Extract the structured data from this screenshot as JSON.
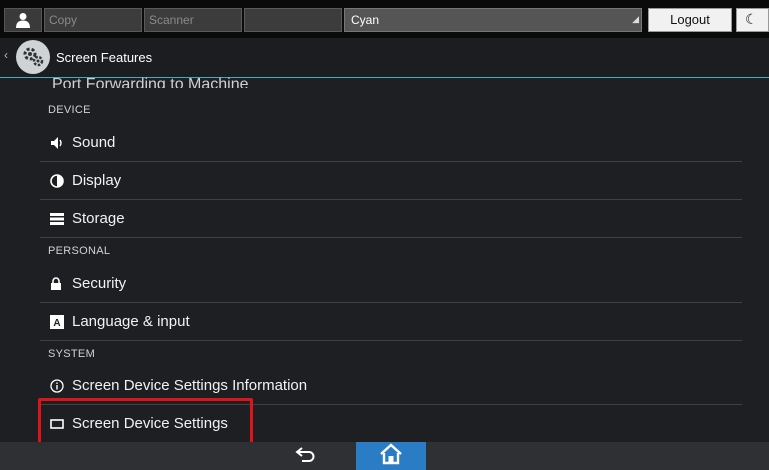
{
  "topbar": {
    "slot1": "Copy",
    "slot2": "Scanner",
    "cyan": "Cyan",
    "logout": "Logout"
  },
  "header": {
    "title": "Screen Features"
  },
  "list": {
    "partial_item": "Port Forwarding to Machine",
    "sections": {
      "device": "DEVICE",
      "personal": "PERSONAL",
      "system": "SYSTEM"
    },
    "items": {
      "sound": "Sound",
      "display": "Display",
      "storage": "Storage",
      "security": "Security",
      "language": "Language & input",
      "device_info": "Screen Device Settings Information",
      "device_settings": "Screen Device Settings"
    }
  },
  "colors": {
    "accent_line": "#4aa6c5",
    "highlight": "#e0121a",
    "home_button": "#2a7cc4"
  }
}
